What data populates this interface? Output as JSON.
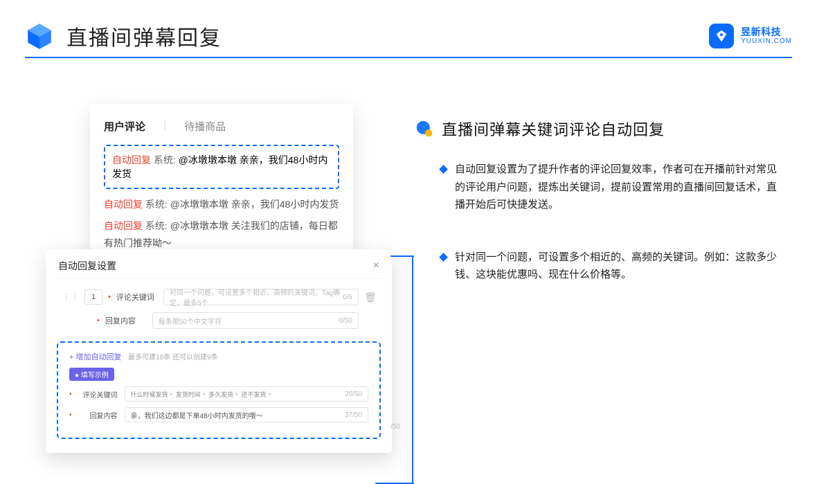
{
  "header": {
    "title": "直播间弹幕回复",
    "brand_cn": "昱新科技",
    "brand_en": "YUUXIN.COM"
  },
  "comments_card": {
    "tab_active": "用户评论",
    "tab_inactive": "待播商品",
    "highlight_tag": "自动回复",
    "highlight_sys": "系统:",
    "highlight_body": "@冰墩墩本墩 亲亲，我们48小时内发货",
    "line2_tag": "自动回复",
    "line2_sys": "系统:",
    "line2_body": "@冰墩墩本墩 亲亲，我们48小时内发货",
    "line3_tag": "自动回复",
    "line3_sys": "系统:",
    "line3_body": "@冰墩墩本墩 关注我们的店铺，每日都有热门推荐呦～"
  },
  "settings_card": {
    "title": "自动回复设置",
    "order": "1",
    "kw_label": "评论关键词",
    "kw_placeholder": "对同一个问题，可设置多个相近、高频的关键词，Tag确定，最多5个",
    "kw_count": "0/5",
    "content_label": "回复内容",
    "content_placeholder": "每条限50个中文字符",
    "content_count": "0/50",
    "add_link": "+ 增加自动回复",
    "add_note": "最多可建10条 还可以创建9条",
    "example_badge": "● 填写示例",
    "ex_kw_label": "评论关键词",
    "ex_chips": [
      "什么时候发货",
      "发货时间",
      "多久发货",
      "还不发货"
    ],
    "ex_kw_count": "20/50",
    "ex_content_label": "回复内容",
    "ex_content_value": "亲，我们这边都是下单48小时内发货的哦～",
    "ex_content_count": "37/50",
    "outside_count": "/50"
  },
  "right": {
    "subhead": "直播间弹幕关键词评论自动回复",
    "bullet1": "自动回复设置为了提升作者的评论回复效率，作者可在开播前针对常见的评论用户问题，提炼出关键词，提前设置常用的直播间回复话术，直播开始后可快捷发送。",
    "bullet2": "针对同一个问题，可设置多个相近的、高频的关键词。例如：这款多少钱、这块能优惠吗、现在什么价格等。"
  }
}
